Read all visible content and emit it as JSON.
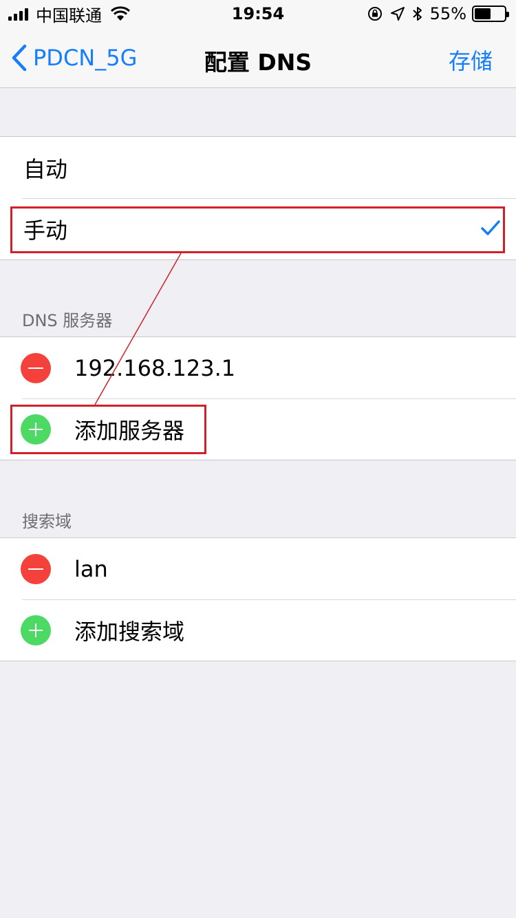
{
  "status_bar": {
    "carrier": "中国联通",
    "time": "19:54",
    "battery_percent": "55%",
    "battery_level": 0.55
  },
  "nav": {
    "back_label": "PDCN_5G",
    "title": "配置 DNS",
    "save_label": "存储"
  },
  "config_modes": {
    "items": [
      {
        "label": "自动",
        "selected": false
      },
      {
        "label": "手动",
        "selected": true
      }
    ]
  },
  "dns_servers": {
    "header": "DNS 服务器",
    "servers": [
      "192.168.123.1"
    ],
    "add_label": "添加服务器"
  },
  "search_domains": {
    "header": "搜索域",
    "domains": [
      "lan"
    ],
    "add_label": "添加搜索域"
  },
  "colors": {
    "accent": "#147efb",
    "delete": "#f4413b",
    "add": "#4cd964",
    "annotation": "#d0212a"
  },
  "icons": {
    "back": "chevron-left-icon",
    "check": "checkmark-icon",
    "wifi": "wifi-icon",
    "orientation_lock": "orientation-lock-icon",
    "location": "location-icon",
    "bluetooth": "bluetooth-icon"
  }
}
